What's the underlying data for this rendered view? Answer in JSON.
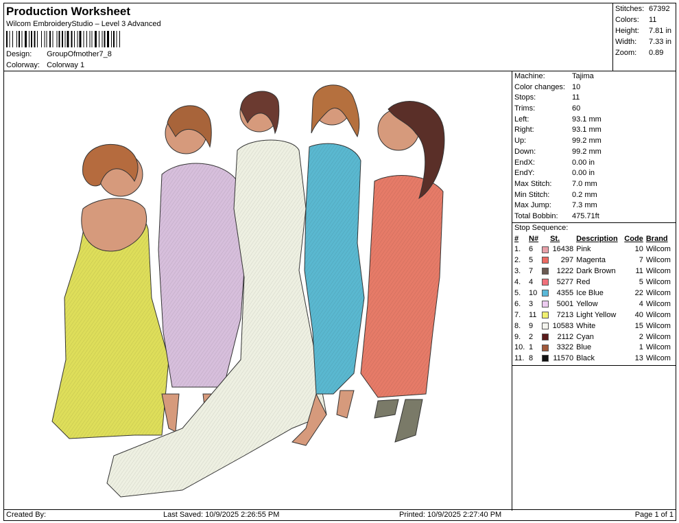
{
  "header": {
    "title": "Production Worksheet",
    "subtitle": "Wilcom EmbroideryStudio – Level 3 Advanced",
    "design_label": "Design:",
    "design_value": "GroupOfmother7_8",
    "colorway_label": "Colorway:",
    "colorway_value": "Colorway 1"
  },
  "stats": [
    {
      "label": "Stitches:",
      "value": "67392"
    },
    {
      "label": "Colors:",
      "value": "11"
    },
    {
      "label": "Height:",
      "value": "7.81 in"
    },
    {
      "label": "Width:",
      "value": "7.33 in"
    },
    {
      "label": "Zoom:",
      "value": "0.89"
    }
  ],
  "machine_info": [
    {
      "label": "Machine:",
      "value": "Tajima"
    },
    {
      "label": "Color changes:",
      "value": "10"
    },
    {
      "label": "Stops:",
      "value": "11"
    },
    {
      "label": "Trims:",
      "value": "60"
    },
    {
      "label": "Left:",
      "value": "93.1 mm"
    },
    {
      "label": "Right:",
      "value": "93.1 mm"
    },
    {
      "label": "Up:",
      "value": "99.2 mm"
    },
    {
      "label": "Down:",
      "value": "99.2 mm"
    },
    {
      "label": "EndX:",
      "value": "0.00 in"
    },
    {
      "label": "EndY:",
      "value": "0.00 in"
    },
    {
      "label": "Max Stitch:",
      "value": "7.0 mm"
    },
    {
      "label": "Min Stitch:",
      "value": "0.2 mm"
    },
    {
      "label": "Max Jump:",
      "value": "7.3 mm"
    },
    {
      "label": "Total Bobbin:",
      "value": "475.71ft"
    }
  ],
  "stop_sequence": {
    "title": "Stop Sequence:",
    "headers": {
      "idx": "#",
      "num": "N#",
      "st": "St.",
      "desc": "Description",
      "code": "Code",
      "brand": "Brand"
    },
    "rows": [
      {
        "idx": "1.",
        "num": "6",
        "color": "#e8a0a8",
        "st": "16438",
        "desc": "Pink",
        "code": "10",
        "brand": "Wilcom"
      },
      {
        "idx": "2.",
        "num": "5",
        "color": "#ec6a62",
        "st": "297",
        "desc": "Magenta",
        "code": "7",
        "brand": "Wilcom"
      },
      {
        "idx": "3.",
        "num": "7",
        "color": "#6b5a52",
        "st": "1222",
        "desc": "Dark Brown",
        "code": "11",
        "brand": "Wilcom"
      },
      {
        "idx": "4.",
        "num": "4",
        "color": "#f0707a",
        "st": "5277",
        "desc": "Red",
        "code": "5",
        "brand": "Wilcom"
      },
      {
        "idx": "5.",
        "num": "10",
        "color": "#5ab8d8",
        "st": "4355",
        "desc": "Ice Blue",
        "code": "22",
        "brand": "Wilcom"
      },
      {
        "idx": "6.",
        "num": "3",
        "color": "#eccbf0",
        "st": "5001",
        "desc": "Yellow",
        "code": "4",
        "brand": "Wilcom"
      },
      {
        "idx": "7.",
        "num": "11",
        "color": "#f0f070",
        "st": "7213",
        "desc": "Light Yellow",
        "code": "40",
        "brand": "Wilcom"
      },
      {
        "idx": "8.",
        "num": "9",
        "color": "#f4f4ee",
        "st": "10583",
        "desc": "White",
        "code": "15",
        "brand": "Wilcom"
      },
      {
        "idx": "9.",
        "num": "2",
        "color": "#5a1a1a",
        "st": "2112",
        "desc": "Cyan",
        "code": "2",
        "brand": "Wilcom"
      },
      {
        "idx": "10.",
        "num": "1",
        "color": "#a0583a",
        "st": "3322",
        "desc": "Blue",
        "code": "1",
        "brand": "Wilcom"
      },
      {
        "idx": "11.",
        "num": "8",
        "color": "#111111",
        "st": "11570",
        "desc": "Black",
        "code": "13",
        "brand": "Wilcom"
      }
    ]
  },
  "footer": {
    "created_by": "Created By:",
    "last_saved": "Last Saved: 10/9/2025 2:26:55 PM",
    "printed": "Printed: 10/9/2025 2:27:40 PM",
    "page": "Page 1 of 1"
  }
}
